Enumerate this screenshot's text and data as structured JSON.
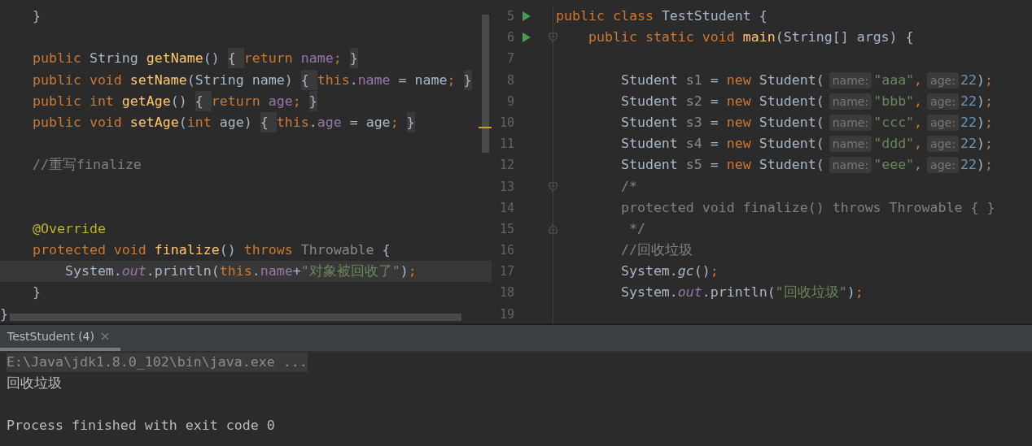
{
  "left_editor": {
    "lines": [
      {
        "current": false,
        "tokens": [
          {
            "text": "    }",
            "kind": "plain"
          }
        ]
      },
      {
        "current": false
      },
      {
        "current": false,
        "tokens": [
          {
            "text": "    public",
            "kind": "kw"
          },
          {
            "text": " String ",
            "kind": "plain"
          },
          {
            "text": "getName",
            "kind": "fn"
          },
          {
            "text": "() ",
            "kind": "plain"
          },
          {
            "text": "{ ",
            "kind": "fold"
          },
          {
            "text": "return ",
            "kind": "kw"
          },
          {
            "text": "name",
            "kind": "field"
          },
          {
            "text": "; ",
            "kind": "kw"
          },
          {
            "text": "}",
            "kind": "fold"
          }
        ]
      },
      {
        "current": false,
        "tokens": [
          {
            "text": "    public void ",
            "kind": "kw"
          },
          {
            "text": "setName",
            "kind": "fn"
          },
          {
            "text": "(String name) ",
            "kind": "plain"
          },
          {
            "text": "{ ",
            "kind": "fold"
          },
          {
            "text": "this",
            "kind": "kw"
          },
          {
            "text": ".",
            "kind": "plain"
          },
          {
            "text": "name",
            "kind": "field"
          },
          {
            "text": " = name",
            "kind": "plain"
          },
          {
            "text": "; ",
            "kind": "kw"
          },
          {
            "text": "}",
            "kind": "fold"
          }
        ]
      },
      {
        "current": false,
        "tokens": [
          {
            "text": "    public int ",
            "kind": "kw"
          },
          {
            "text": "getAge",
            "kind": "fn"
          },
          {
            "text": "() ",
            "kind": "plain"
          },
          {
            "text": "{ ",
            "kind": "fold"
          },
          {
            "text": "return ",
            "kind": "kw"
          },
          {
            "text": "age",
            "kind": "field"
          },
          {
            "text": "; ",
            "kind": "kw"
          },
          {
            "text": "}",
            "kind": "fold"
          }
        ]
      },
      {
        "current": false,
        "tokens": [
          {
            "text": "    public void ",
            "kind": "kw"
          },
          {
            "text": "setAge",
            "kind": "fn"
          },
          {
            "text": "(",
            "kind": "plain"
          },
          {
            "text": "int ",
            "kind": "kw"
          },
          {
            "text": "age) ",
            "kind": "plain"
          },
          {
            "text": "{ ",
            "kind": "fold"
          },
          {
            "text": "this",
            "kind": "kw"
          },
          {
            "text": ".",
            "kind": "plain"
          },
          {
            "text": "age",
            "kind": "field"
          },
          {
            "text": " = age",
            "kind": "plain"
          },
          {
            "text": "; ",
            "kind": "kw"
          },
          {
            "text": "}",
            "kind": "fold"
          }
        ]
      },
      {
        "current": false
      },
      {
        "current": false,
        "tokens": [
          {
            "text": "    //重写finalize",
            "kind": "comment"
          }
        ]
      },
      {
        "current": false
      },
      {
        "current": false
      },
      {
        "current": false,
        "tokens": [
          {
            "text": "    @Override",
            "kind": "ann"
          }
        ]
      },
      {
        "current": false,
        "tokens": [
          {
            "text": "    protected void ",
            "kind": "kw"
          },
          {
            "text": "finalize",
            "kind": "fn"
          },
          {
            "text": "() ",
            "kind": "plain"
          },
          {
            "text": "throws ",
            "kind": "kw"
          },
          {
            "text": "Throwable",
            "kind": "dim"
          },
          {
            "text": " {",
            "kind": "plain"
          }
        ]
      },
      {
        "current": true,
        "tokens": [
          {
            "text": "        System.",
            "kind": "plain"
          },
          {
            "text": "out",
            "kind": "sfield"
          },
          {
            "text": ".println(",
            "kind": "plain"
          },
          {
            "text": "this",
            "kind": "kw"
          },
          {
            "text": ".",
            "kind": "plain"
          },
          {
            "text": "name",
            "kind": "field"
          },
          {
            "text": "+",
            "kind": "plain"
          },
          {
            "text": "\"对象被回收了\"",
            "kind": "str"
          },
          {
            "text": ")",
            "kind": "plain"
          },
          {
            "text": ";",
            "kind": "kw"
          }
        ]
      },
      {
        "current": false,
        "tokens": [
          {
            "text": "    }",
            "kind": "plain"
          }
        ]
      },
      {
        "current": false,
        "tokens": [
          {
            "text": "}",
            "kind": "plain"
          }
        ]
      }
    ]
  },
  "right_editor": {
    "lines": [
      {
        "number": "5",
        "run": true,
        "tokens": [
          {
            "text": "public class ",
            "kind": "kw"
          },
          {
            "text": "TestStudent {",
            "kind": "plain"
          }
        ]
      },
      {
        "number": "6",
        "run": true,
        "fold_marker": {
          "kind": "start"
        },
        "tokens": [
          {
            "text": "    public static void ",
            "kind": "kw"
          },
          {
            "text": "main",
            "kind": "fn"
          },
          {
            "text": "(String[] args) {",
            "kind": "plain"
          }
        ]
      },
      {
        "number": "7",
        "run": false
      },
      {
        "number": "8",
        "run": false,
        "tokens": [
          {
            "text": "        Student ",
            "kind": "plain"
          },
          {
            "text": "s1",
            "kind": "dim"
          },
          {
            "text": " = ",
            "kind": "plain"
          },
          {
            "text": "new ",
            "kind": "kw"
          },
          {
            "text": "Student(",
            "kind": "plain"
          },
          {
            "text": "name:",
            "kind": "hint"
          },
          {
            "text": "\"aaa\"",
            "kind": "str"
          },
          {
            "text": ",",
            "kind": "kw"
          },
          {
            "text": "age:",
            "kind": "hint"
          },
          {
            "text": "22",
            "kind": "num"
          },
          {
            "text": ")",
            "kind": "plain"
          },
          {
            "text": ";",
            "kind": "kw"
          }
        ]
      },
      {
        "number": "9",
        "run": false,
        "tokens": [
          {
            "text": "        Student ",
            "kind": "plain"
          },
          {
            "text": "s2",
            "kind": "dim"
          },
          {
            "text": " = ",
            "kind": "plain"
          },
          {
            "text": "new ",
            "kind": "kw"
          },
          {
            "text": "Student(",
            "kind": "plain"
          },
          {
            "text": "name:",
            "kind": "hint"
          },
          {
            "text": "\"bbb\"",
            "kind": "str"
          },
          {
            "text": ",",
            "kind": "kw"
          },
          {
            "text": "age:",
            "kind": "hint"
          },
          {
            "text": "22",
            "kind": "num"
          },
          {
            "text": ")",
            "kind": "plain"
          },
          {
            "text": ";",
            "kind": "kw"
          }
        ]
      },
      {
        "number": "10",
        "run": false,
        "tokens": [
          {
            "text": "        Student ",
            "kind": "plain"
          },
          {
            "text": "s3",
            "kind": "dim"
          },
          {
            "text": " = ",
            "kind": "plain"
          },
          {
            "text": "new ",
            "kind": "kw"
          },
          {
            "text": "Student(",
            "kind": "plain"
          },
          {
            "text": "name:",
            "kind": "hint"
          },
          {
            "text": "\"ccc\"",
            "kind": "str"
          },
          {
            "text": ",",
            "kind": "kw"
          },
          {
            "text": "age:",
            "kind": "hint"
          },
          {
            "text": "22",
            "kind": "num"
          },
          {
            "text": ")",
            "kind": "plain"
          },
          {
            "text": ";",
            "kind": "kw"
          }
        ]
      },
      {
        "number": "11",
        "run": false,
        "tokens": [
          {
            "text": "        Student ",
            "kind": "plain"
          },
          {
            "text": "s4",
            "kind": "dim"
          },
          {
            "text": " = ",
            "kind": "plain"
          },
          {
            "text": "new ",
            "kind": "kw"
          },
          {
            "text": "Student(",
            "kind": "plain"
          },
          {
            "text": "name:",
            "kind": "hint"
          },
          {
            "text": "\"ddd\"",
            "kind": "str"
          },
          {
            "text": ",",
            "kind": "kw"
          },
          {
            "text": "age:",
            "kind": "hint"
          },
          {
            "text": "22",
            "kind": "num"
          },
          {
            "text": ")",
            "kind": "plain"
          },
          {
            "text": ";",
            "kind": "kw"
          }
        ]
      },
      {
        "number": "12",
        "run": false,
        "tokens": [
          {
            "text": "        Student ",
            "kind": "plain"
          },
          {
            "text": "s5",
            "kind": "dim"
          },
          {
            "text": " = ",
            "kind": "plain"
          },
          {
            "text": "new ",
            "kind": "kw"
          },
          {
            "text": "Student(",
            "kind": "plain"
          },
          {
            "text": "name:",
            "kind": "hint"
          },
          {
            "text": "\"eee\"",
            "kind": "str"
          },
          {
            "text": ",",
            "kind": "kw"
          },
          {
            "text": "age:",
            "kind": "hint"
          },
          {
            "text": "22",
            "kind": "num"
          },
          {
            "text": ")",
            "kind": "plain"
          },
          {
            "text": ";",
            "kind": "kw"
          }
        ]
      },
      {
        "number": "13",
        "run": false,
        "fold_marker": {
          "kind": "start"
        },
        "tokens": [
          {
            "text": "        /*",
            "kind": "comment"
          }
        ]
      },
      {
        "number": "14",
        "run": false,
        "tokens": [
          {
            "text": "        protected void finalize() throws Throwable { }",
            "kind": "comment"
          }
        ]
      },
      {
        "number": "15",
        "run": false,
        "fold_marker": {
          "kind": "end"
        },
        "tokens": [
          {
            "text": "         */",
            "kind": "comment"
          }
        ]
      },
      {
        "number": "16",
        "run": false,
        "tokens": [
          {
            "text": "        //回收垃圾",
            "kind": "comment"
          }
        ]
      },
      {
        "number": "17",
        "run": false,
        "tokens": [
          {
            "text": "        System.",
            "kind": "plain"
          },
          {
            "text": "gc",
            "kind": "scall"
          },
          {
            "text": "()",
            "kind": "plain"
          },
          {
            "text": ";",
            "kind": "kw"
          }
        ]
      },
      {
        "number": "18",
        "run": false,
        "tokens": [
          {
            "text": "        System.",
            "kind": "plain"
          },
          {
            "text": "out",
            "kind": "sfield"
          },
          {
            "text": ".println(",
            "kind": "plain"
          },
          {
            "text": "\"回收垃圾\"",
            "kind": "str"
          },
          {
            "text": ")",
            "kind": "plain"
          },
          {
            "text": ";",
            "kind": "kw"
          }
        ]
      },
      {
        "number": "19",
        "run": false
      }
    ]
  },
  "run_panel": {
    "tabs": [
      {
        "label": "TestStudent (4)",
        "selected": true
      }
    ],
    "console": [
      {
        "kind": "command",
        "text": "E:\\Java\\jdk1.8.0_102\\bin\\java.exe ..."
      },
      {
        "kind": "output",
        "text": "回收垃圾"
      },
      {
        "kind": "blank"
      },
      {
        "kind": "output",
        "text": "Process finished with exit code 0"
      }
    ]
  }
}
